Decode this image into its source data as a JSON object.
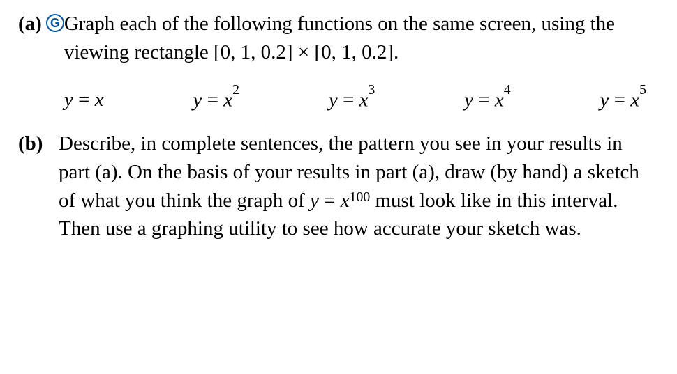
{
  "partA": {
    "label": "(a)",
    "iconLetter": "G",
    "text": "Graph each of the following functions on the same screen, using the viewing rectangle [0, 1, 0.2] × [0, 1, 0.2].",
    "equations": {
      "e1": {
        "lhs": "y",
        "eq": " = ",
        "rhs": "x"
      },
      "e2": {
        "lhs": "y",
        "eq": " = ",
        "rhs": "x",
        "exp": "2"
      },
      "e3": {
        "lhs": "y",
        "eq": " = ",
        "rhs": "x",
        "exp": "3"
      },
      "e4": {
        "lhs": "y",
        "eq": " = ",
        "rhs": "x",
        "exp": "4"
      },
      "e5": {
        "lhs": "y",
        "eq": " = ",
        "rhs": "x",
        "exp": "5"
      }
    }
  },
  "partB": {
    "label": "(b)",
    "t1": "Describe, in complete sentences, the pattern you see in your results in part (a). On the basis of your results in part (a), draw (by hand) a sketch of what you think the graph of ",
    "fn_lhs": "y",
    "fn_eq": " = ",
    "fn_rhs": "x",
    "fn_exp": "100",
    "t2": " must look like in this interval. Then use a graphing utility to see how accurate your sketch was."
  }
}
